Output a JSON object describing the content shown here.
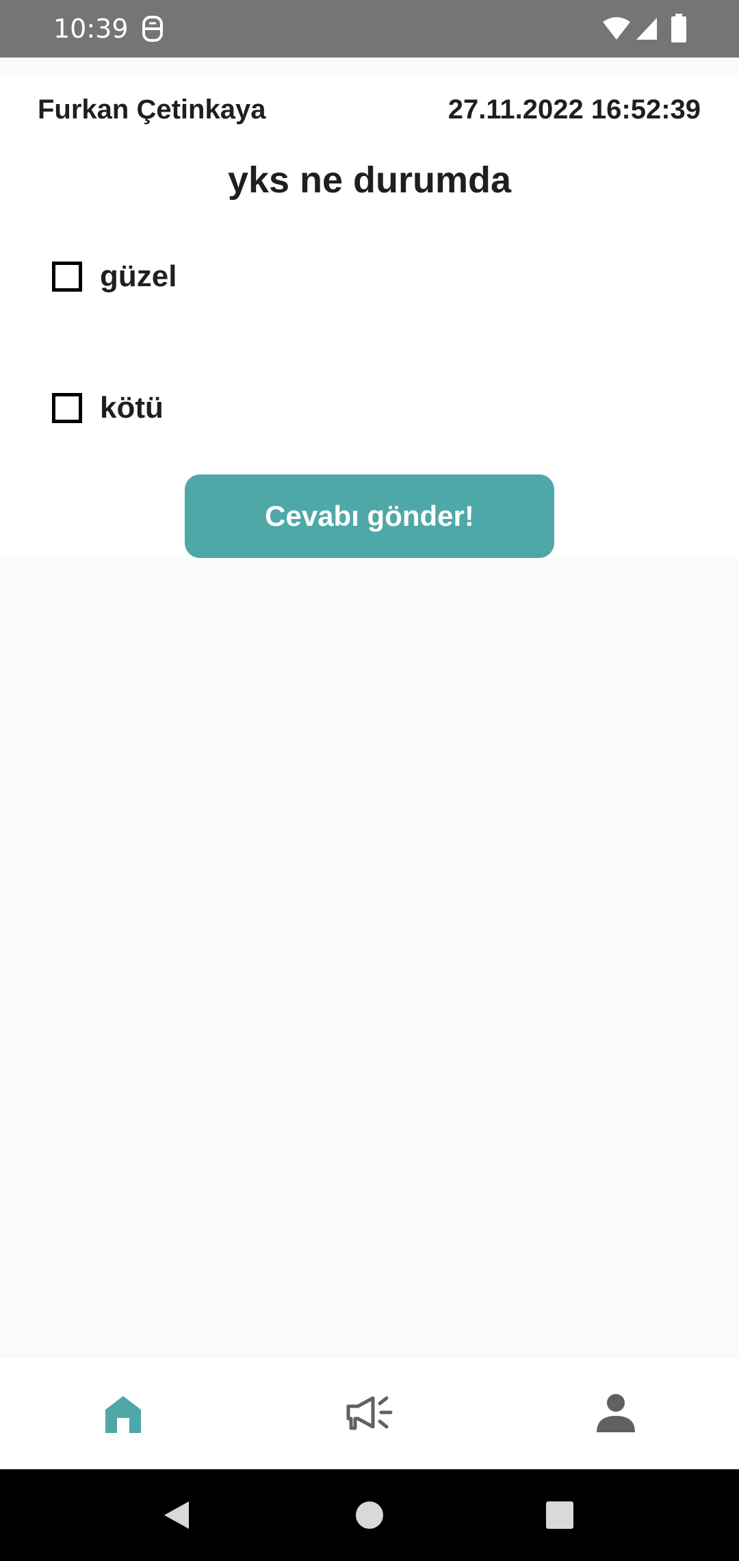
{
  "status_bar": {
    "time": "10:39",
    "icons": [
      "app-notification-icon",
      "wifi-icon",
      "signal-icon",
      "battery-icon"
    ]
  },
  "poll": {
    "author": "Furkan Çetinkaya",
    "timestamp": "27.11.2022 16:52:39",
    "question": "yks ne durumda",
    "options": [
      {
        "label": "güzel",
        "checked": false
      },
      {
        "label": "kötü",
        "checked": false
      }
    ],
    "submit_label": "Cevabı gönder!"
  },
  "bottom_nav": {
    "items": [
      {
        "icon": "home-icon",
        "active": true
      },
      {
        "icon": "megaphone-icon",
        "active": false
      },
      {
        "icon": "person-icon",
        "active": false
      }
    ]
  },
  "colors": {
    "accent": "#4fa8a8",
    "status_bar": "#757575",
    "inactive_icon": "#616161"
  }
}
